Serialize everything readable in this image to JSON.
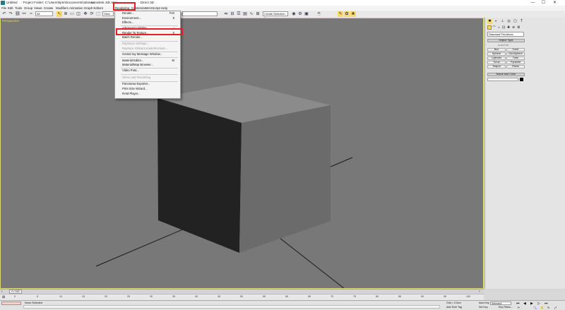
{
  "titlebar": {
    "app_title": "Untitled",
    "project_folder": ": Project Folder: C:\\Users\\kjrte\\Documents\\3dsmax",
    "product": "- Autodesk 3ds Max",
    "product_suffix": "- Direct 3D",
    "minimize": "—",
    "maximize": "☐",
    "close": "✕"
  },
  "menubar": {
    "items": [
      "File",
      "Edit",
      "Tools",
      "Group",
      "Views",
      "Create",
      "Modifiers",
      "Animation",
      "Graph Editors",
      "Rendering",
      "Customize",
      "MAXScript",
      "Help"
    ]
  },
  "toolbar": {
    "selection_filter": "All",
    "named_selection": "",
    "ref_coord": "View",
    "create_selection_set": "Create Selection Se"
  },
  "rendering_menu": {
    "items": [
      {
        "label": "Render...",
        "shortcut": "F10",
        "enabled": true
      },
      {
        "label": "Environment...",
        "shortcut": "8",
        "enabled": true
      },
      {
        "label": "Effects...",
        "shortcut": "",
        "enabled": true
      },
      {
        "label": "Advanced Lighting",
        "shortcut": "›",
        "enabled": true
      },
      {
        "label": "Render To Texture...",
        "shortcut": "0",
        "enabled": true
      },
      {
        "label": "Batch Render...",
        "shortcut": "",
        "enabled": true
      },
      {
        "label": "Raytracer Settings...",
        "shortcut": "",
        "enabled": false
      },
      {
        "label": "Raytrace Global Include/Exclude...",
        "shortcut": "",
        "enabled": false
      },
      {
        "label": "mental ray Message Window...",
        "shortcut": "",
        "enabled": true
      },
      {
        "label": "Material Editor...",
        "shortcut": "M",
        "enabled": true
      },
      {
        "label": "Material/Map Browser...",
        "shortcut": "",
        "enabled": true
      },
      {
        "label": "Video Post...",
        "shortcut": "",
        "enabled": true
      },
      {
        "label": "Show Last Rendering",
        "shortcut": "",
        "enabled": false
      },
      {
        "label": "Panorama Exporter...",
        "shortcut": "",
        "enabled": true
      },
      {
        "label": "Print Size Wizard...",
        "shortcut": "",
        "enabled": true
      },
      {
        "label": "RAM Player...",
        "shortcut": "",
        "enabled": true
      }
    ]
  },
  "viewport": {
    "label": "Perspective",
    "border_color": "#e0d66a",
    "background": "#787878"
  },
  "command_panel": {
    "category": "Standard Primitives",
    "object_type_header": "Object Type",
    "autogrid": "AutoGrid",
    "buttons": [
      "Box",
      "Cone",
      "Sphere",
      "GeoSphere",
      "Cylinder",
      "Tube",
      "Torus",
      "Pyramid",
      "Teapot",
      "Plane"
    ],
    "name_color_header": "Name and Color"
  },
  "time_slider": {
    "label": "0 / 100"
  },
  "track_ticks": [
    "0",
    "5",
    "10",
    "15",
    "20",
    "25",
    "30",
    "35",
    "40",
    "45",
    "50",
    "55",
    "60",
    "65",
    "70",
    "75",
    "80",
    "85",
    "90",
    "95",
    "100"
  ],
  "statusbar": {
    "selection_status": "None Selected",
    "grid": "Grid = 0.0cm",
    "add_time_tag": "Add Time Tag",
    "auto_key": "Auto Key",
    "set_key": "Set Key",
    "selected": "Selected",
    "key_filters": "Key Filters..."
  },
  "accent": {
    "highlight_red": "#e0202a",
    "menu_bg": "#f4f4f4"
  }
}
